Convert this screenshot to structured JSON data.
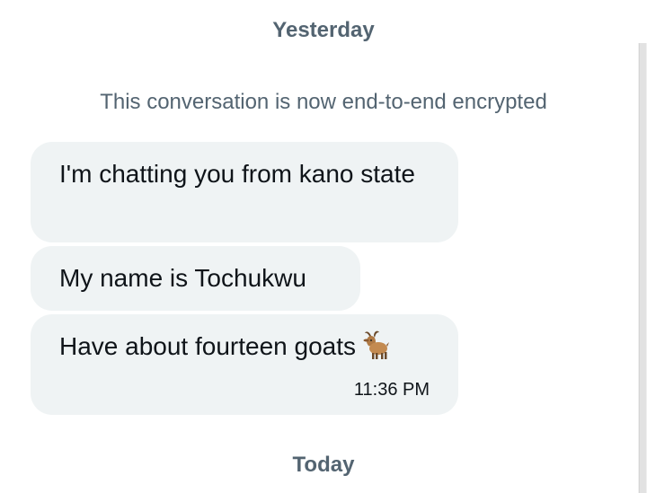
{
  "separators": {
    "yesterday": "Yesterday",
    "today": "Today"
  },
  "notice": "This conversation is now end-to-end encrypted",
  "messages": [
    {
      "text": "I'm chatting you from kano state"
    },
    {
      "text": "My name is Tochukwu"
    },
    {
      "text": "Have about fourteen goats",
      "emoji": "goat-emoji",
      "time": "11:36 PM"
    }
  ]
}
